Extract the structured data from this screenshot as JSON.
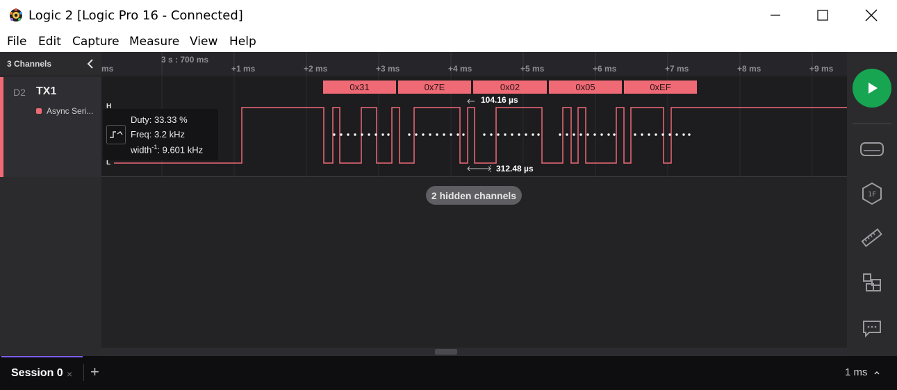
{
  "window": {
    "title": "Logic 2 [Logic Pro 16 - Connected]",
    "minimize": "minimize",
    "maximize": "maximize",
    "close": "close"
  },
  "menu": [
    "File",
    "Edit",
    "Capture",
    "Measure",
    "View",
    "Help"
  ],
  "left_panel": {
    "channels_count": "3 Channels",
    "channel": {
      "id": "D2",
      "name": "TX1",
      "analyzer": "Async Seri..."
    }
  },
  "timeline": {
    "main_label": "3 s : 700 ms",
    "left_partial": "ms",
    "ticks": [
      "+1 ms",
      "+2 ms",
      "+3 ms",
      "+4 ms",
      "+5 ms",
      "+6 ms",
      "+7 ms",
      "+8 ms",
      "+9 ms"
    ]
  },
  "waveform": {
    "high_label": "H",
    "low_label": "L",
    "decoded": [
      "0x31",
      "0x7E",
      "0x02",
      "0x05",
      "0xEF"
    ],
    "bit_width": "104.16 µs",
    "pulse_width": "312.48 µs"
  },
  "measurement": {
    "duty": "Duty: 33.33 %",
    "freq": "Freq: 3.2 kHz",
    "width_prefix": "width",
    "width_sup": "-1",
    "width_value": ": 9.601 kHz"
  },
  "hidden_channels": "2 hidden channels",
  "sidebar_icons": [
    "play-icon",
    "analyzers-icon",
    "extensions-icon",
    "measure-ruler-icon",
    "layout-icon",
    "feedback-icon"
  ],
  "session": {
    "name": "Session 0",
    "close": "×",
    "add": "+",
    "zoom": "1 ms"
  },
  "colors": {
    "accent": "#ef6a75",
    "play": "#17a552",
    "session_tab": "#7b5cff"
  }
}
